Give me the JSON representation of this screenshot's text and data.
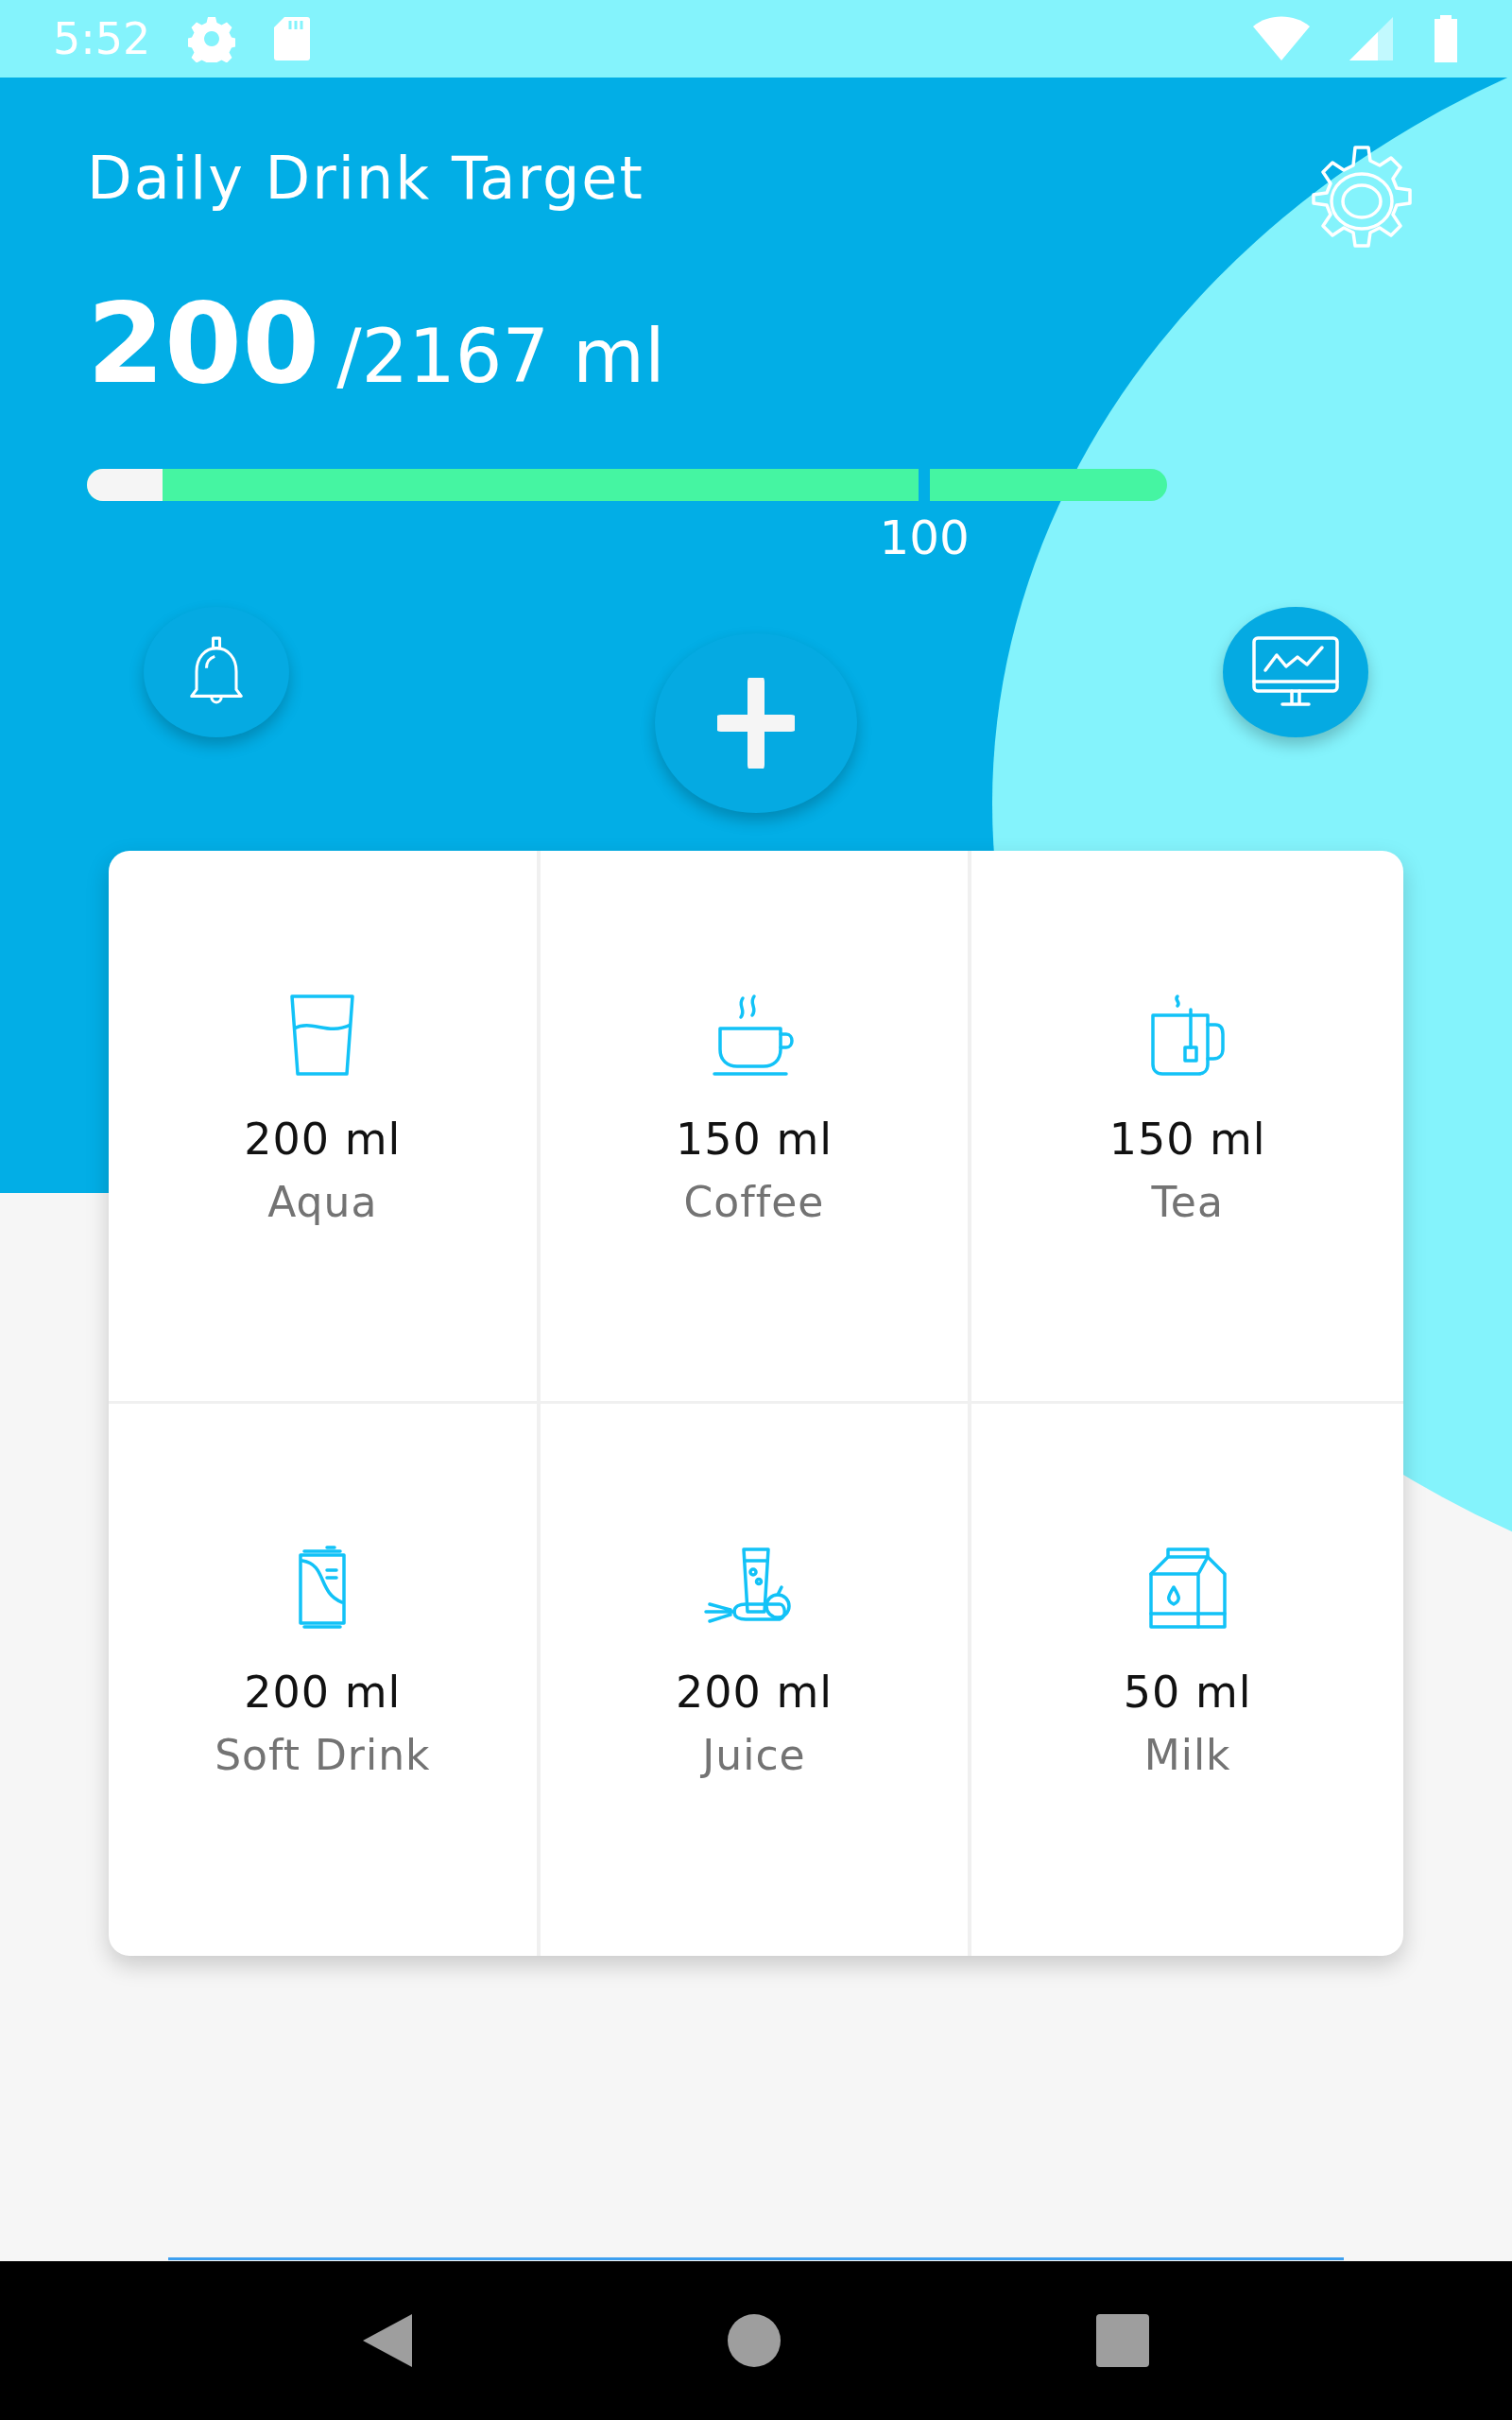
{
  "status_bar": {
    "time": "5:52"
  },
  "header": {
    "title": "Daily Drink Target",
    "consumed": "200",
    "target": "/2167 ml"
  },
  "progress": {
    "level": 0.07,
    "marker": {
      "label": "100",
      "level": 0.77
    }
  },
  "actions": [
    {
      "kind": "bell"
    },
    {
      "kind": "add"
    },
    {
      "kind": "chart"
    }
  ],
  "drinks": [
    {
      "kind": "glass",
      "amount": "200 ml",
      "name": "Aqua"
    },
    {
      "kind": "coffee",
      "amount": "150 ml",
      "name": "Coffee"
    },
    {
      "kind": "tea",
      "amount": "150 ml",
      "name": "Tea"
    },
    {
      "kind": "can",
      "amount": "200 ml",
      "name": "Soft Drink"
    },
    {
      "kind": "juice",
      "amount": "200 ml",
      "name": "Juice"
    },
    {
      "kind": "milk",
      "amount": "50 ml",
      "name": "Milk"
    }
  ]
}
